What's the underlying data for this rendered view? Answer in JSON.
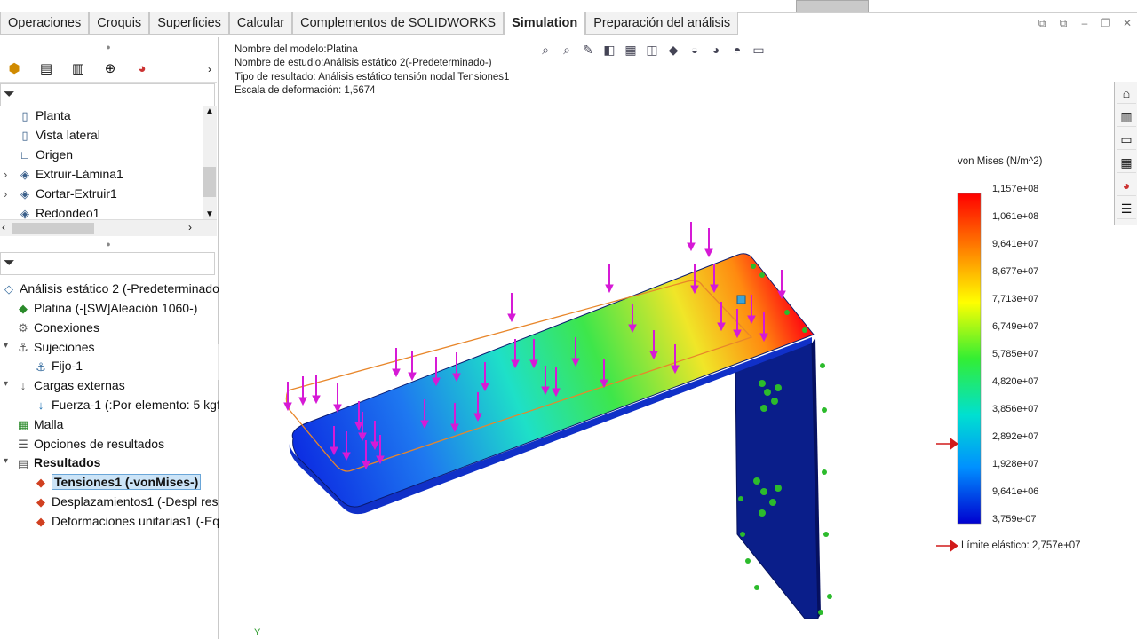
{
  "command_tabs": [
    "Operaciones",
    "Croquis",
    "Superficies",
    "Calcular",
    "Complementos de SOLIDWORKS",
    "Simulation",
    "Preparación del análisis"
  ],
  "active_tab": "Simulation",
  "feature_tree": {
    "items": [
      "Planta",
      "Vista lateral",
      "Origen",
      "Extruir-Lámina1",
      "Cortar-Extruir1",
      "Redondeo1"
    ]
  },
  "study_tree": {
    "root": "Análisis estático 2 (-Predeterminado-",
    "items": [
      {
        "label": "Platina (-[SW]Aleación 1060-)",
        "level": 1
      },
      {
        "label": "Conexiones",
        "level": 1
      },
      {
        "label": "Sujeciones",
        "level": 1
      },
      {
        "label": "Fijo-1",
        "level": 2
      },
      {
        "label": "Cargas externas",
        "level": 1
      },
      {
        "label": "Fuerza-1 (:Por elemento: 5 kgf:",
        "level": 2
      },
      {
        "label": "Malla",
        "level": 1
      },
      {
        "label": "Opciones de resultados",
        "level": 1
      },
      {
        "label": "Resultados",
        "level": 1
      },
      {
        "label": "Tensiones1 (-vonMises-)",
        "level": 2
      },
      {
        "label": "Desplazamientos1 (-Despl res",
        "level": 2
      },
      {
        "label": "Deformaciones unitarias1 (-Eq",
        "level": 2
      }
    ]
  },
  "viewport": {
    "model_name": "Nombre del modelo:Platina",
    "study_name": "Nombre de estudio:Análisis estático 2(-Predeterminado-)",
    "result_type": "Tipo de resultado: Análisis estático tensión nodal Tensiones1",
    "deform_scale": "Escala de deformación: 1,5674",
    "triad_label": "Y"
  },
  "legend": {
    "title": "von Mises (N/m^2)",
    "values": [
      "1,157e+08",
      "1,061e+08",
      "9,641e+07",
      "8,677e+07",
      "7,713e+07",
      "6,749e+07",
      "5,785e+07",
      "4,820e+07",
      "3,856e+07",
      "2,892e+07",
      "1,928e+07",
      "9,641e+06",
      "3,759e-07"
    ],
    "yield_label": "Límite elástico: 2,757e+07",
    "arrow_color": "#d11a1a"
  },
  "colors": {
    "max": "#ff0000",
    "min": "#0000c8",
    "load_arrow": "#d61ad6",
    "fixture": "#22bb22"
  }
}
